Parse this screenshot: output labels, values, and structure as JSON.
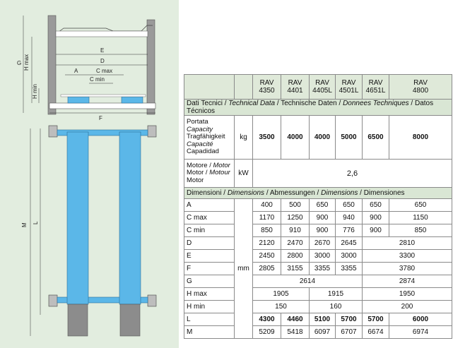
{
  "drawing": {
    "labels": {
      "G": "G",
      "Hmax": "H max",
      "Hmin": "H min",
      "E": "E",
      "D": "D",
      "A": "A",
      "Cmax": "C max",
      "Cmin": "C min",
      "F": "F",
      "M": "M",
      "L": "L"
    }
  },
  "table": {
    "models": [
      {
        "l1": "RAV",
        "l2": "4350"
      },
      {
        "l1": "RAV",
        "l2": "4401"
      },
      {
        "l1": "RAV",
        "l2": "4405L"
      },
      {
        "l1": "RAV",
        "l2": "4501L"
      },
      {
        "l1": "RAV",
        "l2": "4651L"
      },
      {
        "l1": "RAV",
        "l2": "4800"
      }
    ],
    "sec_tech": {
      "a": "Dati Tecnici / ",
      "b": "Technical Data",
      "c": " / Technische Daten / ",
      "d": "Donnees Techniques",
      "e": " / Datos Técnicos"
    },
    "capacity": {
      "l1": "Portata",
      "l2": "Capacity",
      "l3": "Tragfähigkeit",
      "l4": "Capacité",
      "l5": "Capadidad",
      "unit": "kg",
      "values": [
        "3500",
        "4000",
        "4000",
        "5000",
        "6500",
        "8000"
      ]
    },
    "motor": {
      "l1a": "Motore / ",
      "l1b": "Motor",
      "l2a": "Motor / ",
      "l2b": "Motour",
      "l3": "Motor",
      "unit": "kW",
      "value": "2,6"
    },
    "sec_dim": {
      "a": "Dimensioni / ",
      "b": "Dimensions",
      "c": " / Abmessungen / ",
      "d": "Dimensions",
      "e": " / Dimensiones"
    },
    "unit_mm": "mm",
    "rows": {
      "A": {
        "label": "A",
        "v": [
          "400",
          "500",
          "650",
          "650",
          "650",
          "650"
        ]
      },
      "Cmax": {
        "label": "C max",
        "v": [
          "1170",
          "1250",
          "900",
          "940",
          "900",
          "1150"
        ]
      },
      "Cmin": {
        "label": "C min",
        "v": [
          "850",
          "910",
          "900",
          "776",
          "900",
          "850"
        ]
      },
      "D": {
        "label": "D",
        "v": [
          "2120",
          "2470",
          "2670",
          "2645",
          "2810"
        ]
      },
      "E": {
        "label": "E",
        "v": [
          "2450",
          "2800",
          "3000",
          "3000",
          "3300"
        ]
      },
      "F": {
        "label": "F",
        "v": [
          "2805",
          "3155",
          "3355",
          "3355",
          "3780"
        ]
      },
      "G": {
        "label": "G",
        "v": [
          "2614",
          "2874"
        ]
      },
      "Hmax": {
        "label": "H max",
        "v": [
          "1905",
          "1915",
          "1950"
        ]
      },
      "Hmin": {
        "label": "H min",
        "v": [
          "150",
          "160",
          "200"
        ]
      },
      "L": {
        "label": "L",
        "v": [
          "4300",
          "4460",
          "5100",
          "5700",
          "5700",
          "6000"
        ]
      },
      "M": {
        "label": "M",
        "v": [
          "5209",
          "5418",
          "6097",
          "6707",
          "6674",
          "6974"
        ]
      }
    }
  },
  "colors": {
    "panel": "#e2eddf",
    "ramp": "#5bb7e8",
    "post": "#8c8c8c",
    "header": "#dfe9d9"
  }
}
